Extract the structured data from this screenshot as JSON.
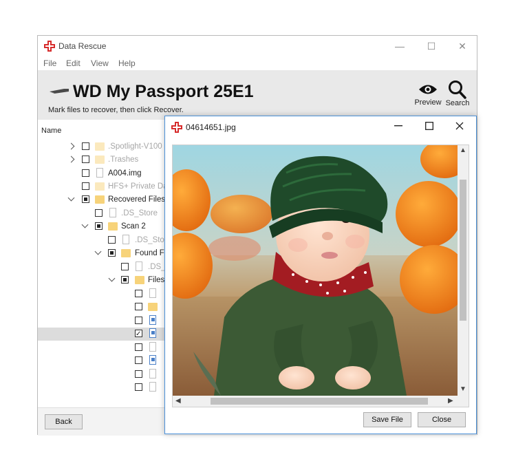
{
  "main": {
    "title": "Data Rescue",
    "window_controls": {
      "minimize": "—",
      "maximize": "☐",
      "close": "✕"
    },
    "menu": [
      "File",
      "Edit",
      "View",
      "Help"
    ],
    "drive_title": "WD My Passport 25E1",
    "subtitle": "Mark files to recover, then click Recover.",
    "tools": {
      "preview": "Preview",
      "search": "Search"
    },
    "column_name": "Name",
    "tree": [
      {
        "label": ".Spotlight-V100",
        "faded": true
      },
      {
        "label": ".Trashes",
        "faded": true
      },
      {
        "label": "A004.img",
        "faded": false
      },
      {
        "label": "HFS+ Private Da",
        "faded": true
      },
      {
        "label": "Recovered Files",
        "faded": false
      },
      {
        "label": ".DS_Store",
        "faded": true
      },
      {
        "label": "Scan 2",
        "faded": false
      },
      {
        "label": ".DS_Stor",
        "faded": true
      },
      {
        "label": "Found F",
        "faded": false
      },
      {
        "label": ".DS_",
        "faded": true
      },
      {
        "label": "Files",
        "faded": false
      }
    ],
    "back_label": "Back"
  },
  "preview": {
    "title": "04614651.jpg",
    "save_label": "Save File",
    "close_label": "Close"
  }
}
